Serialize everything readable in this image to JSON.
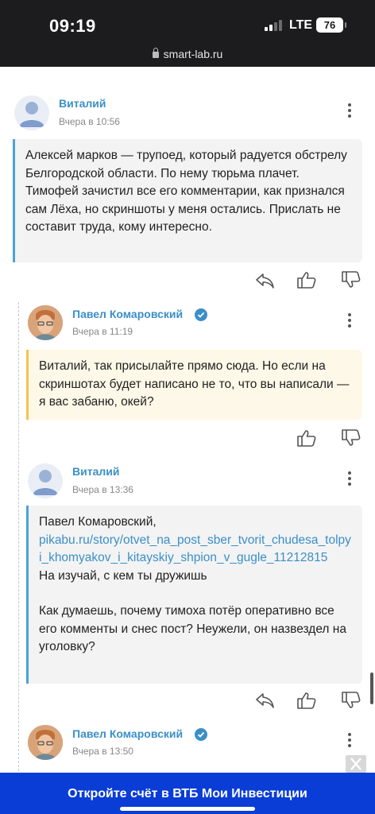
{
  "status_bar": {
    "time": "09:19",
    "network": "LTE",
    "battery": "76"
  },
  "browser": {
    "url": "smart-lab.ru"
  },
  "comments": [
    {
      "author": "Виталий",
      "date": "Вчера в 10:56",
      "text": "Алексей марков — трупоед, который радуется обстрелу Белгородской области. По нему тюрьма плачет. Тимофей зачистил все его комментарии, как признался сам Лёха, но скриншоты у меня остались. Прислать не составит труда, кому интересно."
    },
    {
      "author": "Павел Комаровский",
      "date": "Вчера в 11:19",
      "text": "Виталий, так присылайте прямо сюда. Но если на скриншотах будет написано не то, что вы написали — я вас забаню, окей?"
    },
    {
      "author": "Виталий",
      "date": "Вчера в 13:36",
      "text_line1": "Павел Комаровский,",
      "link": "pikabu.ru/story/otvet_na_post_sber_tvorit_chudesa_tolpyi_khomyakov_i_kitayskiy_shpion_v_gugle_11212815",
      "text_line2": "На изучай, с кем ты дружишь",
      "text_line3": "Как думаешь, почему тимоха потёр оперативно все его комменты и снес пост? Неужели, он назвездел на уголовку?"
    },
    {
      "author": "Павел Комаровский",
      "date": "Вчера в 13:50"
    }
  ],
  "icons": {
    "reply": "reply-arrow-icon",
    "like": "thumbs-up-icon",
    "dislike": "thumbs-down-icon",
    "more": "more-vertical-icon",
    "verified": "verified-badge-icon"
  },
  "colors": {
    "accent": "#3b8fc7",
    "reply_border": "#4ca3d8",
    "author_border": "#f5c053",
    "banner": "#0a3dd6"
  },
  "banner": {
    "text": "Откройте счёт в ВТБ Мои Инвестиции"
  }
}
